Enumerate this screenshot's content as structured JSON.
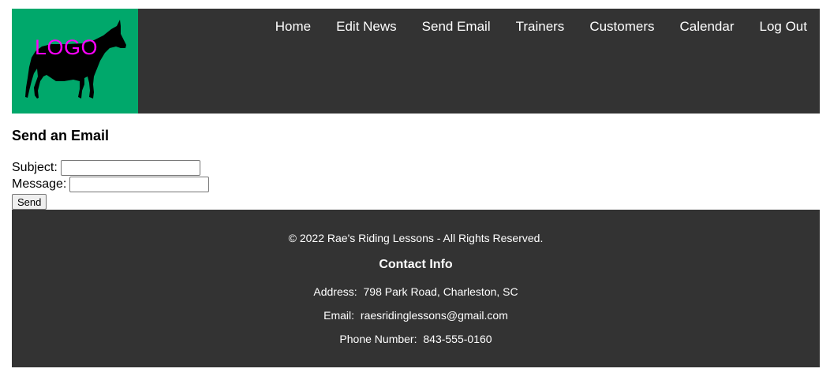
{
  "header": {
    "logo_text": "LOGO",
    "logo_bg": "#00a86b",
    "logo_text_color": "#ff00ff",
    "bg": "#333333",
    "nav": [
      {
        "label": "Home"
      },
      {
        "label": "Edit News"
      },
      {
        "label": "Send Email"
      },
      {
        "label": "Trainers"
      },
      {
        "label": "Customers"
      },
      {
        "label": "Calendar"
      },
      {
        "label": "Log Out"
      }
    ]
  },
  "main": {
    "title": "Send an Email",
    "subject_label": "Subject:",
    "subject_value": "",
    "message_label": "Message:",
    "message_value": "",
    "send_label": "Send"
  },
  "footer": {
    "copyright": "© 2022 Rae's Riding Lessons - All Rights Reserved.",
    "contact_title": "Contact Info",
    "address_label": "Address:",
    "address_value": "798 Park Road, Charleston, SC",
    "email_label": "Email:",
    "email_value": "raesridinglessons@gmail.com",
    "phone_label": "Phone Number:",
    "phone_value": "843-555-0160"
  }
}
